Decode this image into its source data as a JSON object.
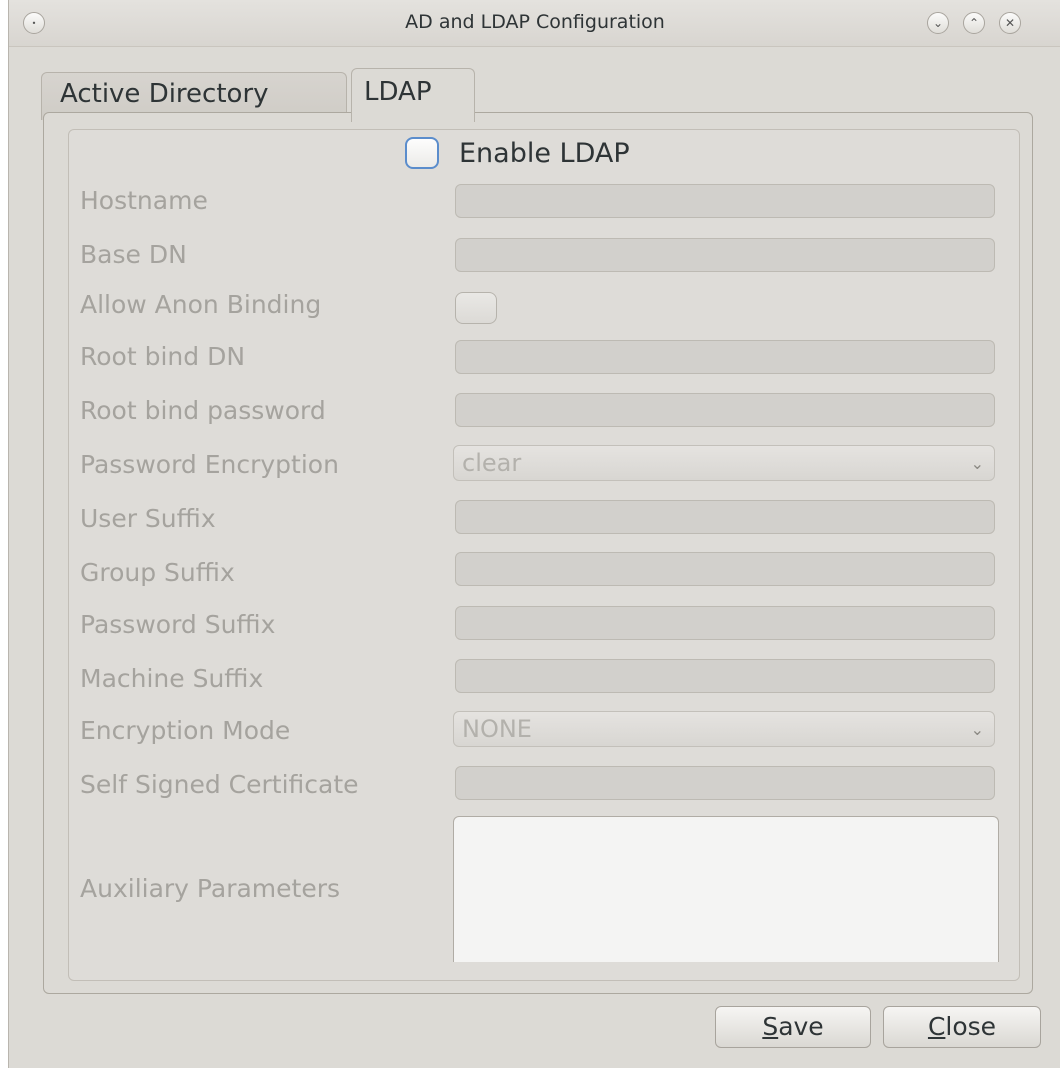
{
  "window": {
    "title": "AD and LDAP Configuration",
    "menu_glyph": "•",
    "min_glyph": "⌄",
    "max_glyph": "⌃",
    "close_glyph": "✕"
  },
  "tabs": [
    {
      "label": "Active Directory",
      "selected": false
    },
    {
      "label": "LDAP",
      "selected": true
    }
  ],
  "ldap": {
    "enable_label": "Enable LDAP",
    "enable_checked": false,
    "labels": {
      "hostname": "Hostname",
      "base_dn": "Base DN",
      "allow_anon": "Allow Anon Binding",
      "root_bind_dn": "Root bind DN",
      "root_bind_password": "Root bind password",
      "password_encryption": "Password Encryption",
      "user_suffix": "User Suffix",
      "group_suffix": "Group Suffix",
      "password_suffix": "Password Suffix",
      "machine_suffix": "Machine Suffix",
      "encryption_mode": "Encryption Mode",
      "self_signed_cert": "Self Signed Certificate",
      "aux_params": "Auxiliary Parameters"
    },
    "values": {
      "hostname": "",
      "base_dn": "",
      "allow_anon": false,
      "root_bind_dn": "",
      "root_bind_password": "",
      "password_encryption": "clear",
      "user_suffix": "",
      "group_suffix": "",
      "password_suffix": "",
      "machine_suffix": "",
      "encryption_mode": "NONE",
      "self_signed_cert": "",
      "aux_params": ""
    },
    "combo_arrow": "⌄"
  },
  "buttons": {
    "save_mnemonic": "S",
    "save_rest": "ave",
    "close_mnemonic": "C",
    "close_rest": "lose"
  }
}
